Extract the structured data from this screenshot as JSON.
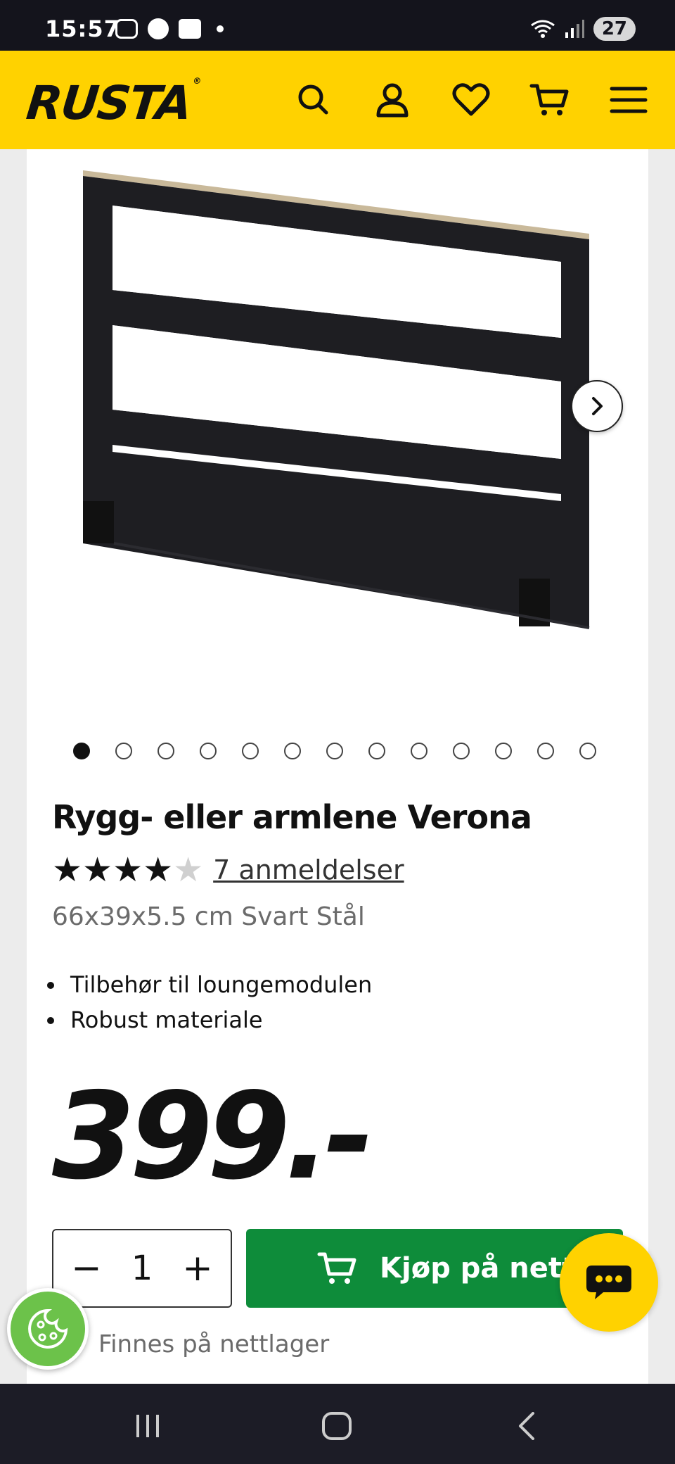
{
  "status_bar": {
    "time": "15:57",
    "battery": "27",
    "icons": [
      "screenshot-icon",
      "messenger-icon",
      "calendar-icon",
      "wifi-icon",
      "signal-icon"
    ]
  },
  "header": {
    "logo": "RUSTA",
    "logo_mark": "®",
    "brand_color": "#ffd200",
    "icons": [
      "search-icon",
      "account-icon",
      "heart-icon",
      "cart-icon",
      "menu-icon"
    ]
  },
  "gallery": {
    "image_count": 13,
    "active_index": 0,
    "next_icon": "chevron-right-icon"
  },
  "product": {
    "title": "Rygg- eller armlene Verona",
    "rating": 4,
    "rating_max": 5,
    "reviews": "7 anmeldelser",
    "dimensions": "66x39x5.5 cm Svart Stål",
    "features": [
      "Tilbehør til loungemodulen",
      "Robust materiale"
    ],
    "price": "399.-"
  },
  "purchase": {
    "minus": "−",
    "quantity": "1",
    "plus": "+",
    "buy_label": "Kjøp på nett",
    "buy_color": "#0e8c3a",
    "stock_status": "Finnes på nettlager"
  }
}
